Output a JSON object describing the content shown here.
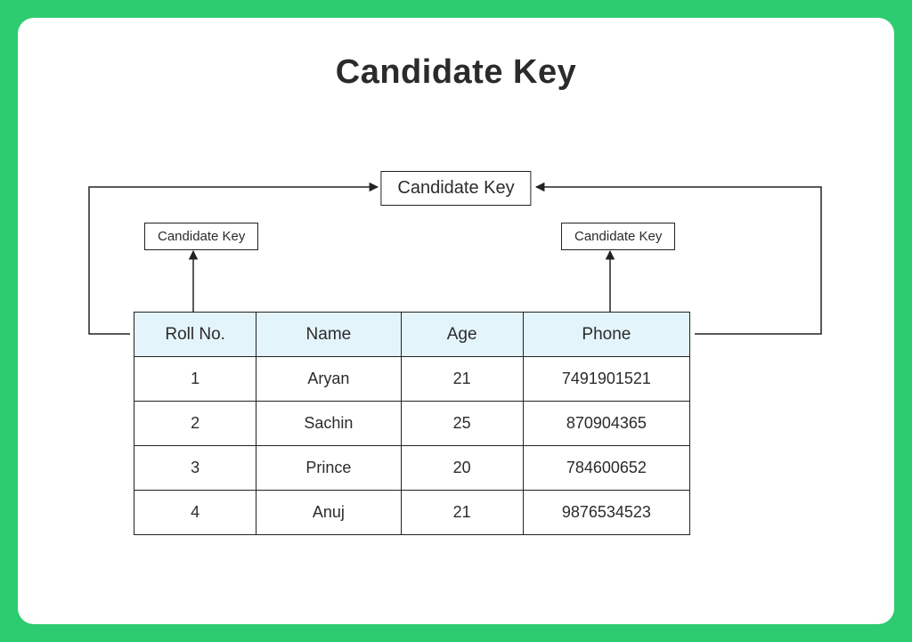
{
  "title": "Candidate Key",
  "labels": {
    "top": "Candidate Key",
    "left": "Candidate Key",
    "right": "Candidate Key"
  },
  "table": {
    "headers": [
      "Roll No.",
      "Name",
      "Age",
      "Phone"
    ],
    "rows": [
      {
        "roll": "1",
        "name": "Aryan",
        "age": "21",
        "phone": "7491901521"
      },
      {
        "roll": "2",
        "name": "Sachin",
        "age": "25",
        "phone": "870904365"
      },
      {
        "roll": "3",
        "name": "Prince",
        "age": "20",
        "phone": "784600652"
      },
      {
        "roll": "4",
        "name": "Anuj",
        "age": "21",
        "phone": "9876534523"
      }
    ]
  }
}
